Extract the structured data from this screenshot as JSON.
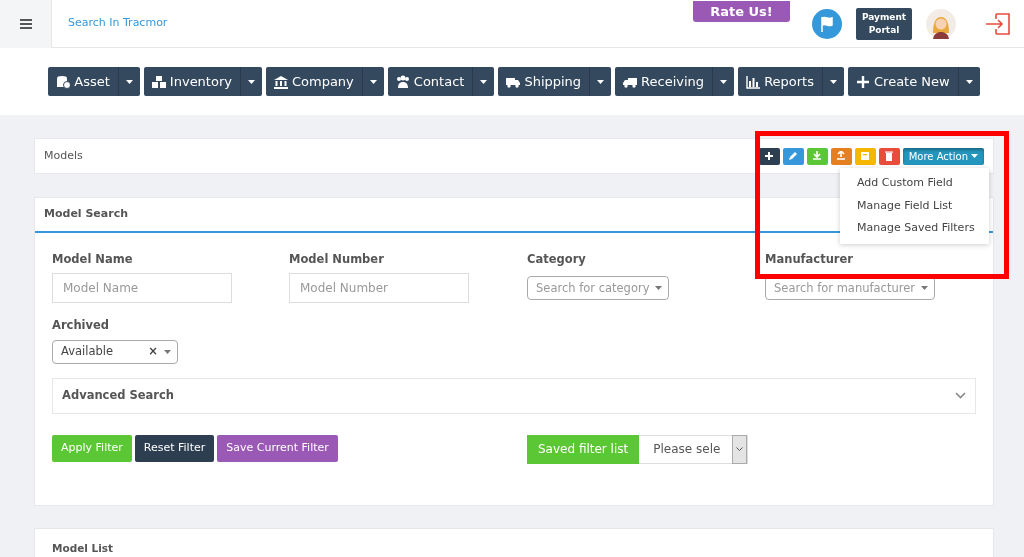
{
  "header": {
    "search_link": "Search In Tracmor",
    "rate_button": "Rate Us!",
    "payment_button": "Payment Portal"
  },
  "nav": [
    {
      "label": "Asset"
    },
    {
      "label": "Inventory"
    },
    {
      "label": "Company"
    },
    {
      "label": "Contact"
    },
    {
      "label": "Shipping"
    },
    {
      "label": "Receiving"
    },
    {
      "label": "Reports"
    },
    {
      "label": "Create New"
    }
  ],
  "models_panel": {
    "title": "Models",
    "action_buttons": [
      {
        "kind": "add",
        "color": "#2c3e50"
      },
      {
        "kind": "edit",
        "color": "#3498db"
      },
      {
        "kind": "download",
        "color": "#5cc734"
      },
      {
        "kind": "upload",
        "color": "#e67e22"
      },
      {
        "kind": "archive",
        "color": "#f5b700"
      },
      {
        "kind": "delete",
        "color": "#e74c3c"
      }
    ],
    "more_action": {
      "label": "More Action",
      "expanded": true,
      "items": [
        "Add Custom Field",
        "Manage Field List",
        "Manage Saved Filters"
      ]
    }
  },
  "model_search": {
    "title": "Model Search",
    "fields": [
      {
        "kind": "text",
        "label": "Model Name",
        "placeholder": "Model Name"
      },
      {
        "kind": "text",
        "label": "Model Number",
        "placeholder": "Model Number"
      },
      {
        "kind": "select",
        "label": "Category",
        "placeholder": "Search for category"
      },
      {
        "kind": "select",
        "label": "Manufacturer",
        "placeholder": "Search for manufacturer"
      },
      {
        "kind": "select",
        "label": "Archived",
        "value": "Available",
        "clear_button": "×"
      }
    ],
    "advanced_search": {
      "title": "Advanced Search",
      "expanded": false
    },
    "buttons": [
      {
        "label": "Apply Filter",
        "color": "#5cc734"
      },
      {
        "label": "Reset Filter",
        "color": "#2c3e50"
      },
      {
        "label": "Save Current Filter",
        "color": "#9b59b6"
      }
    ],
    "saved_filter": {
      "label": "Saved filter list",
      "value": "Please sele"
    }
  },
  "model_list": {
    "title": "Model List"
  }
}
